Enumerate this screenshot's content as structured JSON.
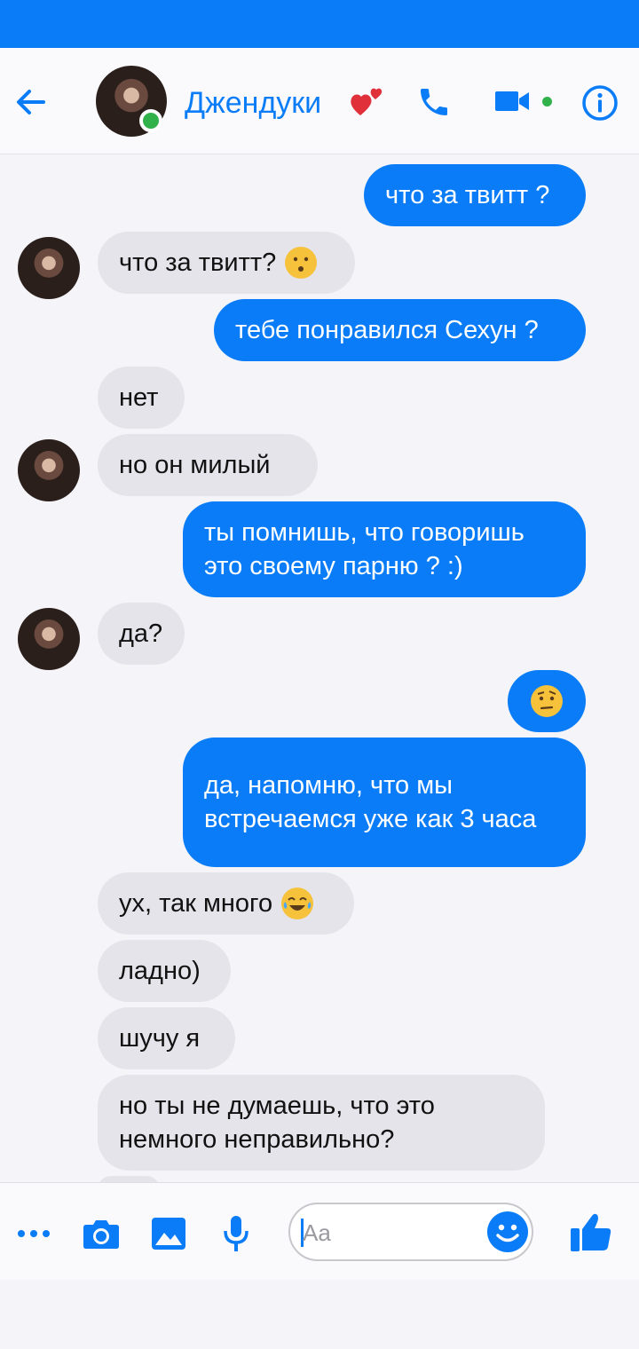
{
  "header": {
    "contact_name": "Джендуки",
    "icons": {
      "back": "arrow-left-icon",
      "heart": "two-hearts-icon",
      "phone": "phone-icon",
      "video": "video-camera-icon",
      "info": "info-icon"
    }
  },
  "messages": [
    {
      "side": "out",
      "text": "что за твитт ?"
    },
    {
      "side": "in",
      "text": "что за твитт?",
      "emoji": "kissing-face"
    },
    {
      "side": "out",
      "text": "тебе понравился Сехун ?"
    },
    {
      "side": "in",
      "text": "нет"
    },
    {
      "side": "in",
      "text": "но он милый"
    },
    {
      "side": "out",
      "text": "ты помнишь, что говоришь это своему парню ? :)"
    },
    {
      "side": "in",
      "text": "да?"
    },
    {
      "side": "out",
      "emoji": "face-with-raised-eyebrow"
    },
    {
      "side": "out",
      "text": "да, напомню, что мы встречаемся уже как 3 часа"
    },
    {
      "side": "in",
      "text": "ух, так много",
      "emoji": "tears-of-joy"
    },
    {
      "side": "in",
      "text": "ладно)"
    },
    {
      "side": "in",
      "text": "шучу я"
    },
    {
      "side": "in",
      "text": "но ты не думаешь, что это немного неправильно?"
    }
  ],
  "composer": {
    "placeholder": "Aa",
    "icons": [
      "more-icon",
      "camera-icon",
      "image-icon",
      "microphone-icon",
      "emoji-icon",
      "thumbs-up-icon"
    ]
  },
  "colors": {
    "accent": "#0a7cf7",
    "incoming_bubble": "#e5e4ea",
    "online": "#31b14a"
  }
}
